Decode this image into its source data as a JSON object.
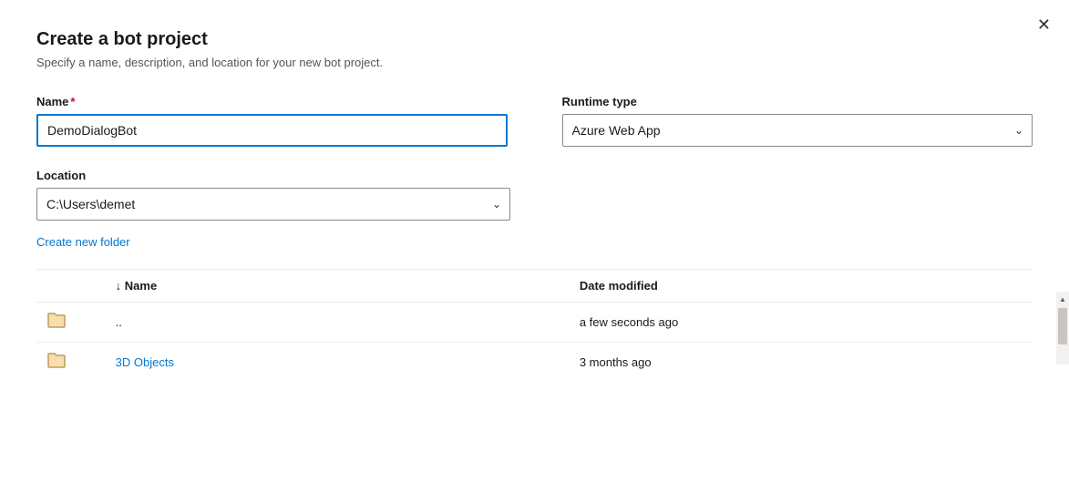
{
  "dialog": {
    "title": "Create a bot project",
    "subtitle": "Specify a name, description, and location for your new bot project."
  },
  "form": {
    "name_label": "Name",
    "name_required": "*",
    "name_value": "DemoDialogBot",
    "runtime_label": "Runtime type",
    "runtime_value": "Azure Web App",
    "location_label": "Location",
    "location_value": "C:\\Users\\demet",
    "create_folder_link": "Create new folder"
  },
  "table": {
    "col_name_label": "Name",
    "col_date_label": "Date modified",
    "sort_arrow": "↓",
    "rows": [
      {
        "icon": "folder",
        "name": "..",
        "name_type": "plain",
        "date": "a few seconds ago"
      },
      {
        "icon": "folder",
        "name": "3D Objects",
        "name_type": "link",
        "date": "3 months ago"
      }
    ]
  },
  "close_label": "✕",
  "chevron_down": "⌄",
  "icons": {
    "folder": "⊳",
    "sort_down": "↓"
  }
}
